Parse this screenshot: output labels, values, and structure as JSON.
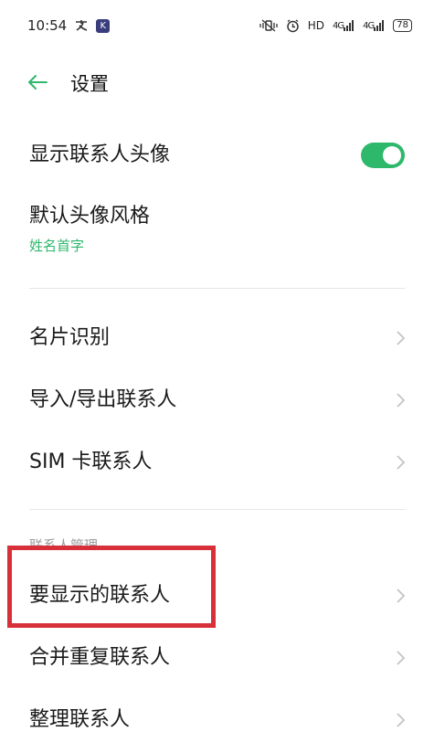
{
  "status_bar": {
    "time": "10:54",
    "app_icon_text": "K",
    "hd_text": "HD",
    "signal1_label": "4G",
    "signal2_label": "4G",
    "battery": "78"
  },
  "header": {
    "title": "设置"
  },
  "items": {
    "show_avatar": {
      "label": "显示联系人头像",
      "enabled": true
    },
    "avatar_style": {
      "label": "默认头像风格",
      "value": "姓名首字"
    },
    "card_recognition": {
      "label": "名片识别"
    },
    "import_export": {
      "label": "导入/导出联系人"
    },
    "sim_contacts": {
      "label": "SIM 卡联系人"
    },
    "contacts_to_display": {
      "label": "要显示的联系人"
    },
    "merge_duplicates": {
      "label": "合并重复联系人"
    },
    "organize_contacts": {
      "label": "整理联系人"
    }
  },
  "section": {
    "contact_management": "联系人管理"
  },
  "colors": {
    "accent": "#2eb86b",
    "highlight": "#d8303b",
    "divider": "#e6e6e6",
    "chevron": "#c4c4c4"
  }
}
